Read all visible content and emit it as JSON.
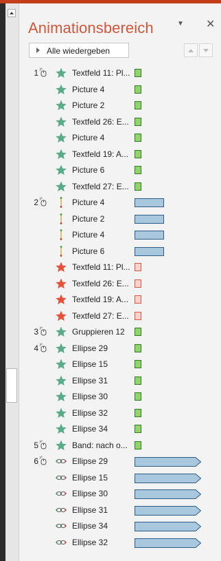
{
  "panel": {
    "title": "Animationsbereich",
    "menu_label": "▼",
    "close_label": "✕",
    "play_all_label": "Alle wiedergeben"
  },
  "colors": {
    "entrance_star": "#5aab8a",
    "emphasis_line": "#c0504d",
    "exit_star": "#e8503a",
    "green_fill": "#92d36e",
    "green_border": "#2f7a22",
    "red_fill": "#fad2cc",
    "red_border": "#d35a4a",
    "blue_fill": "#a9c8de",
    "blue_border": "#2d5d8a"
  },
  "items": [
    {
      "num": "1",
      "click": true,
      "effect": "entrance-star",
      "name": "Textfeld 11: Pl...",
      "timeline": "green-short"
    },
    {
      "num": "",
      "click": false,
      "effect": "entrance-star",
      "name": "Picture 4",
      "timeline": "green-short"
    },
    {
      "num": "",
      "click": false,
      "effect": "entrance-star",
      "name": "Picture 2",
      "timeline": "green-short"
    },
    {
      "num": "",
      "click": false,
      "effect": "entrance-star",
      "name": "Textfeld 26: E...",
      "timeline": "green-short"
    },
    {
      "num": "",
      "click": false,
      "effect": "entrance-star",
      "name": "Picture 4",
      "timeline": "green-short"
    },
    {
      "num": "",
      "click": false,
      "effect": "entrance-star",
      "name": "Textfeld 19: A...",
      "timeline": "green-short"
    },
    {
      "num": "",
      "click": false,
      "effect": "entrance-star",
      "name": "Picture 6",
      "timeline": "green-short"
    },
    {
      "num": "",
      "click": false,
      "effect": "entrance-star",
      "name": "Textfeld 27: E...",
      "timeline": "green-short"
    },
    {
      "num": "2",
      "click": true,
      "effect": "motion-line",
      "name": "Picture 4",
      "timeline": "blue-bar"
    },
    {
      "num": "",
      "click": false,
      "effect": "motion-line",
      "name": "Picture 2",
      "timeline": "blue-bar"
    },
    {
      "num": "",
      "click": false,
      "effect": "motion-line",
      "name": "Picture 4",
      "timeline": "blue-bar"
    },
    {
      "num": "",
      "click": false,
      "effect": "motion-line",
      "name": "Picture 6",
      "timeline": "blue-bar"
    },
    {
      "num": "",
      "click": false,
      "effect": "exit-star",
      "name": "Textfeld 11: Pl...",
      "timeline": "red-short"
    },
    {
      "num": "",
      "click": false,
      "effect": "exit-star",
      "name": "Textfeld 26: E...",
      "timeline": "red-short"
    },
    {
      "num": "",
      "click": false,
      "effect": "exit-star",
      "name": "Textfeld 19: A...",
      "timeline": "red-short"
    },
    {
      "num": "",
      "click": false,
      "effect": "exit-star",
      "name": "Textfeld 27: E...",
      "timeline": "red-short"
    },
    {
      "num": "3",
      "click": true,
      "effect": "entrance-star",
      "name": "Gruppieren 12",
      "timeline": "green-short"
    },
    {
      "num": "4",
      "click": true,
      "effect": "entrance-star",
      "name": "Ellipse 29",
      "timeline": "green-short"
    },
    {
      "num": "",
      "click": false,
      "effect": "entrance-star",
      "name": "Ellipse 15",
      "timeline": "green-short"
    },
    {
      "num": "",
      "click": false,
      "effect": "entrance-star",
      "name": "Ellipse 31",
      "timeline": "green-short"
    },
    {
      "num": "",
      "click": false,
      "effect": "entrance-star",
      "name": "Ellipse 30",
      "timeline": "green-short"
    },
    {
      "num": "",
      "click": false,
      "effect": "entrance-star",
      "name": "Ellipse 32",
      "timeline": "green-short"
    },
    {
      "num": "",
      "click": false,
      "effect": "entrance-star",
      "name": "Ellipse 34",
      "timeline": "green-short"
    },
    {
      "num": "5",
      "click": true,
      "effect": "entrance-star",
      "name": "Band: nach o...",
      "timeline": "green-short"
    },
    {
      "num": "6",
      "click": true,
      "effect": "loop",
      "name": "Ellipse 29",
      "timeline": "blue-arrow"
    },
    {
      "num": "",
      "click": false,
      "effect": "loop",
      "name": "Ellipse 15",
      "timeline": "blue-arrow"
    },
    {
      "num": "",
      "click": false,
      "effect": "loop",
      "name": "Ellipse 30",
      "timeline": "blue-arrow"
    },
    {
      "num": "",
      "click": false,
      "effect": "loop",
      "name": "Ellipse 31",
      "timeline": "blue-arrow"
    },
    {
      "num": "",
      "click": false,
      "effect": "loop",
      "name": "Ellipse 34",
      "timeline": "blue-arrow"
    },
    {
      "num": "",
      "click": false,
      "effect": "loop",
      "name": "Ellipse 32",
      "timeline": "blue-arrow"
    }
  ]
}
